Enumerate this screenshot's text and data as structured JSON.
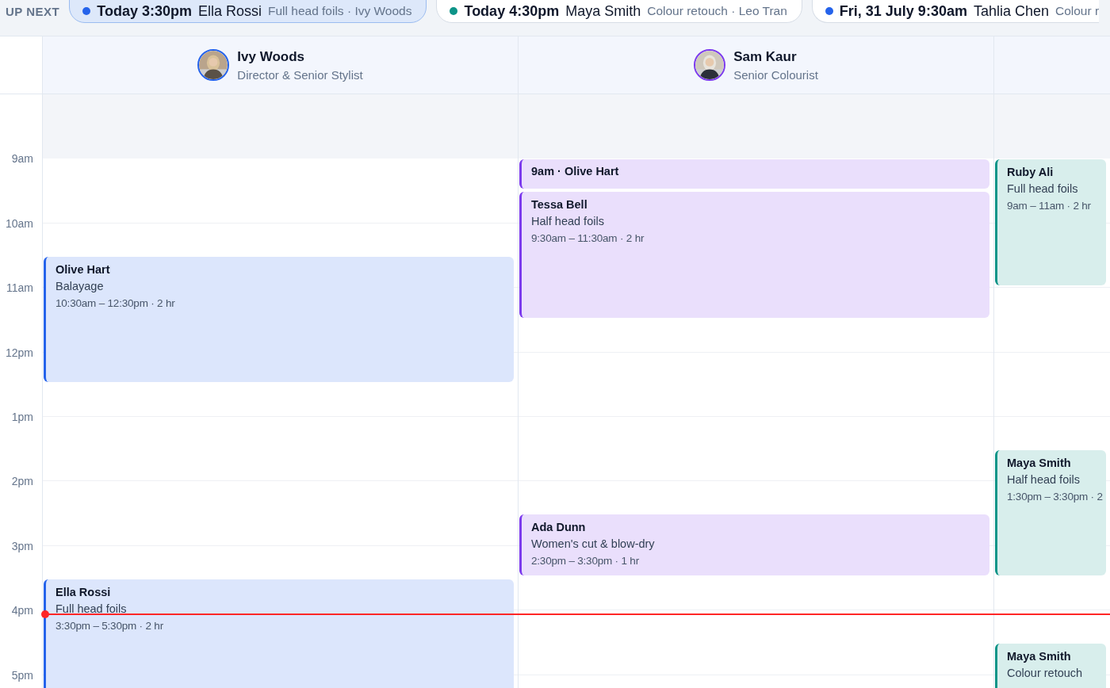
{
  "up_next": {
    "label": "UP NEXT",
    "items": [
      {
        "time": "Today 3:30pm",
        "client": "Ella Rossi",
        "detail": "Full head foils · Ivy Woods",
        "color": "#2563eb",
        "selected": true
      },
      {
        "time": "Today 4:30pm",
        "client": "Maya Smith",
        "detail": "Colour retouch · Leo Tran",
        "color": "#0d9488",
        "selected": false
      },
      {
        "time": "Fri, 31 July 9:30am",
        "client": "Tahlia Chen",
        "detail": "Colour r",
        "color": "#2563eb",
        "selected": false
      }
    ]
  },
  "time_labels": [
    "9am",
    "10am",
    "11am",
    "12pm",
    "1pm",
    "2pm",
    "3pm",
    "4pm",
    "5pm"
  ],
  "staff": [
    {
      "name": "Ivy Woods",
      "role": "Director & Senior Stylist",
      "color": "#2563eb",
      "appointments": [
        {
          "kind": "full",
          "client": "Olive Hart",
          "service": "Balayage",
          "time": "10:30am – 12:30pm · 2 hr"
        },
        {
          "kind": "full",
          "client": "Ella Rossi",
          "service": "Full head foils",
          "time": "3:30pm – 5:30pm · 2 hr"
        }
      ]
    },
    {
      "name": "Sam Kaur",
      "role": "Senior Colourist",
      "color": "#7c3aed",
      "appointments": [
        {
          "kind": "compact",
          "title": "9am · Olive Hart"
        },
        {
          "kind": "full",
          "client": "Tessa Bell",
          "service": "Half head foils",
          "time": "9:30am – 11:30am · 2 hr"
        },
        {
          "kind": "full",
          "client": "Ada Dunn",
          "service": "Women's cut & blow-dry",
          "time": "2:30pm – 3:30pm · 1 hr"
        }
      ]
    },
    {
      "color": "#0d9488",
      "appointments": [
        {
          "kind": "full",
          "client": "Ruby Ali",
          "service": "Full head foils",
          "time": "9am – 11am · 2 hr"
        },
        {
          "kind": "full",
          "client": "Maya Smith",
          "service": "Half head foils",
          "time": "1:30pm – 3:30pm · 2"
        },
        {
          "kind": "full",
          "client": "Maya Smith",
          "service": "Colour retouch"
        }
      ]
    }
  ]
}
